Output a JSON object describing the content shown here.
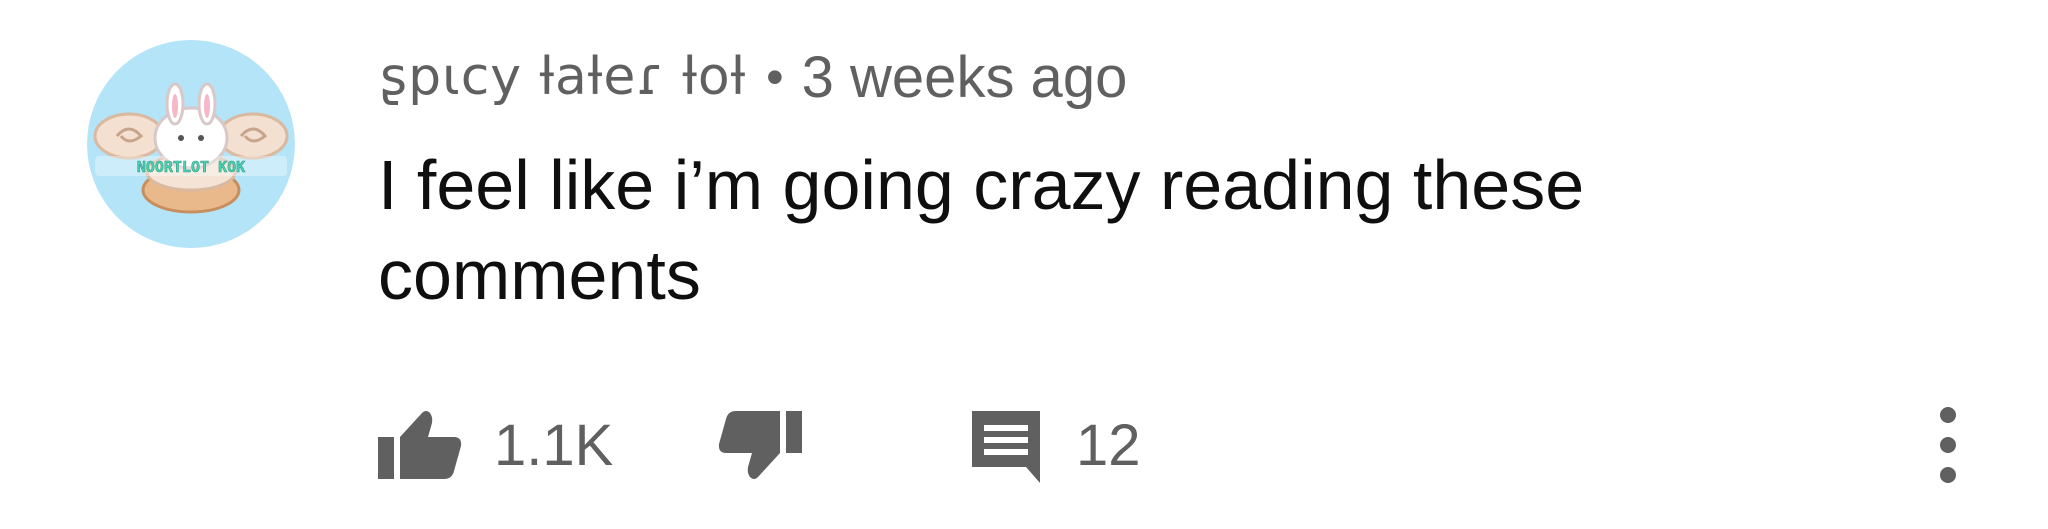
{
  "comment": {
    "author": "ʂpɩcy ƚaƚeɾ ƚoƚ",
    "separator": "•",
    "time_ago": "3 weeks ago",
    "text": "I feel like i’m going crazy reading these comments",
    "avatar_label": "NOORTLOT KOK",
    "avatar_colors": {
      "background": "#b3e4f8",
      "text": "#4fd3b4"
    }
  },
  "actions": {
    "like_count": "1.1K",
    "reply_count": "12",
    "icons": {
      "like": "thumbs-up-icon",
      "dislike": "thumbs-down-icon",
      "reply": "comment-icon",
      "more": "more-vertical-icon"
    }
  },
  "colors": {
    "text_primary": "#0f0f0f",
    "text_secondary": "#606060",
    "icon": "#606060"
  }
}
